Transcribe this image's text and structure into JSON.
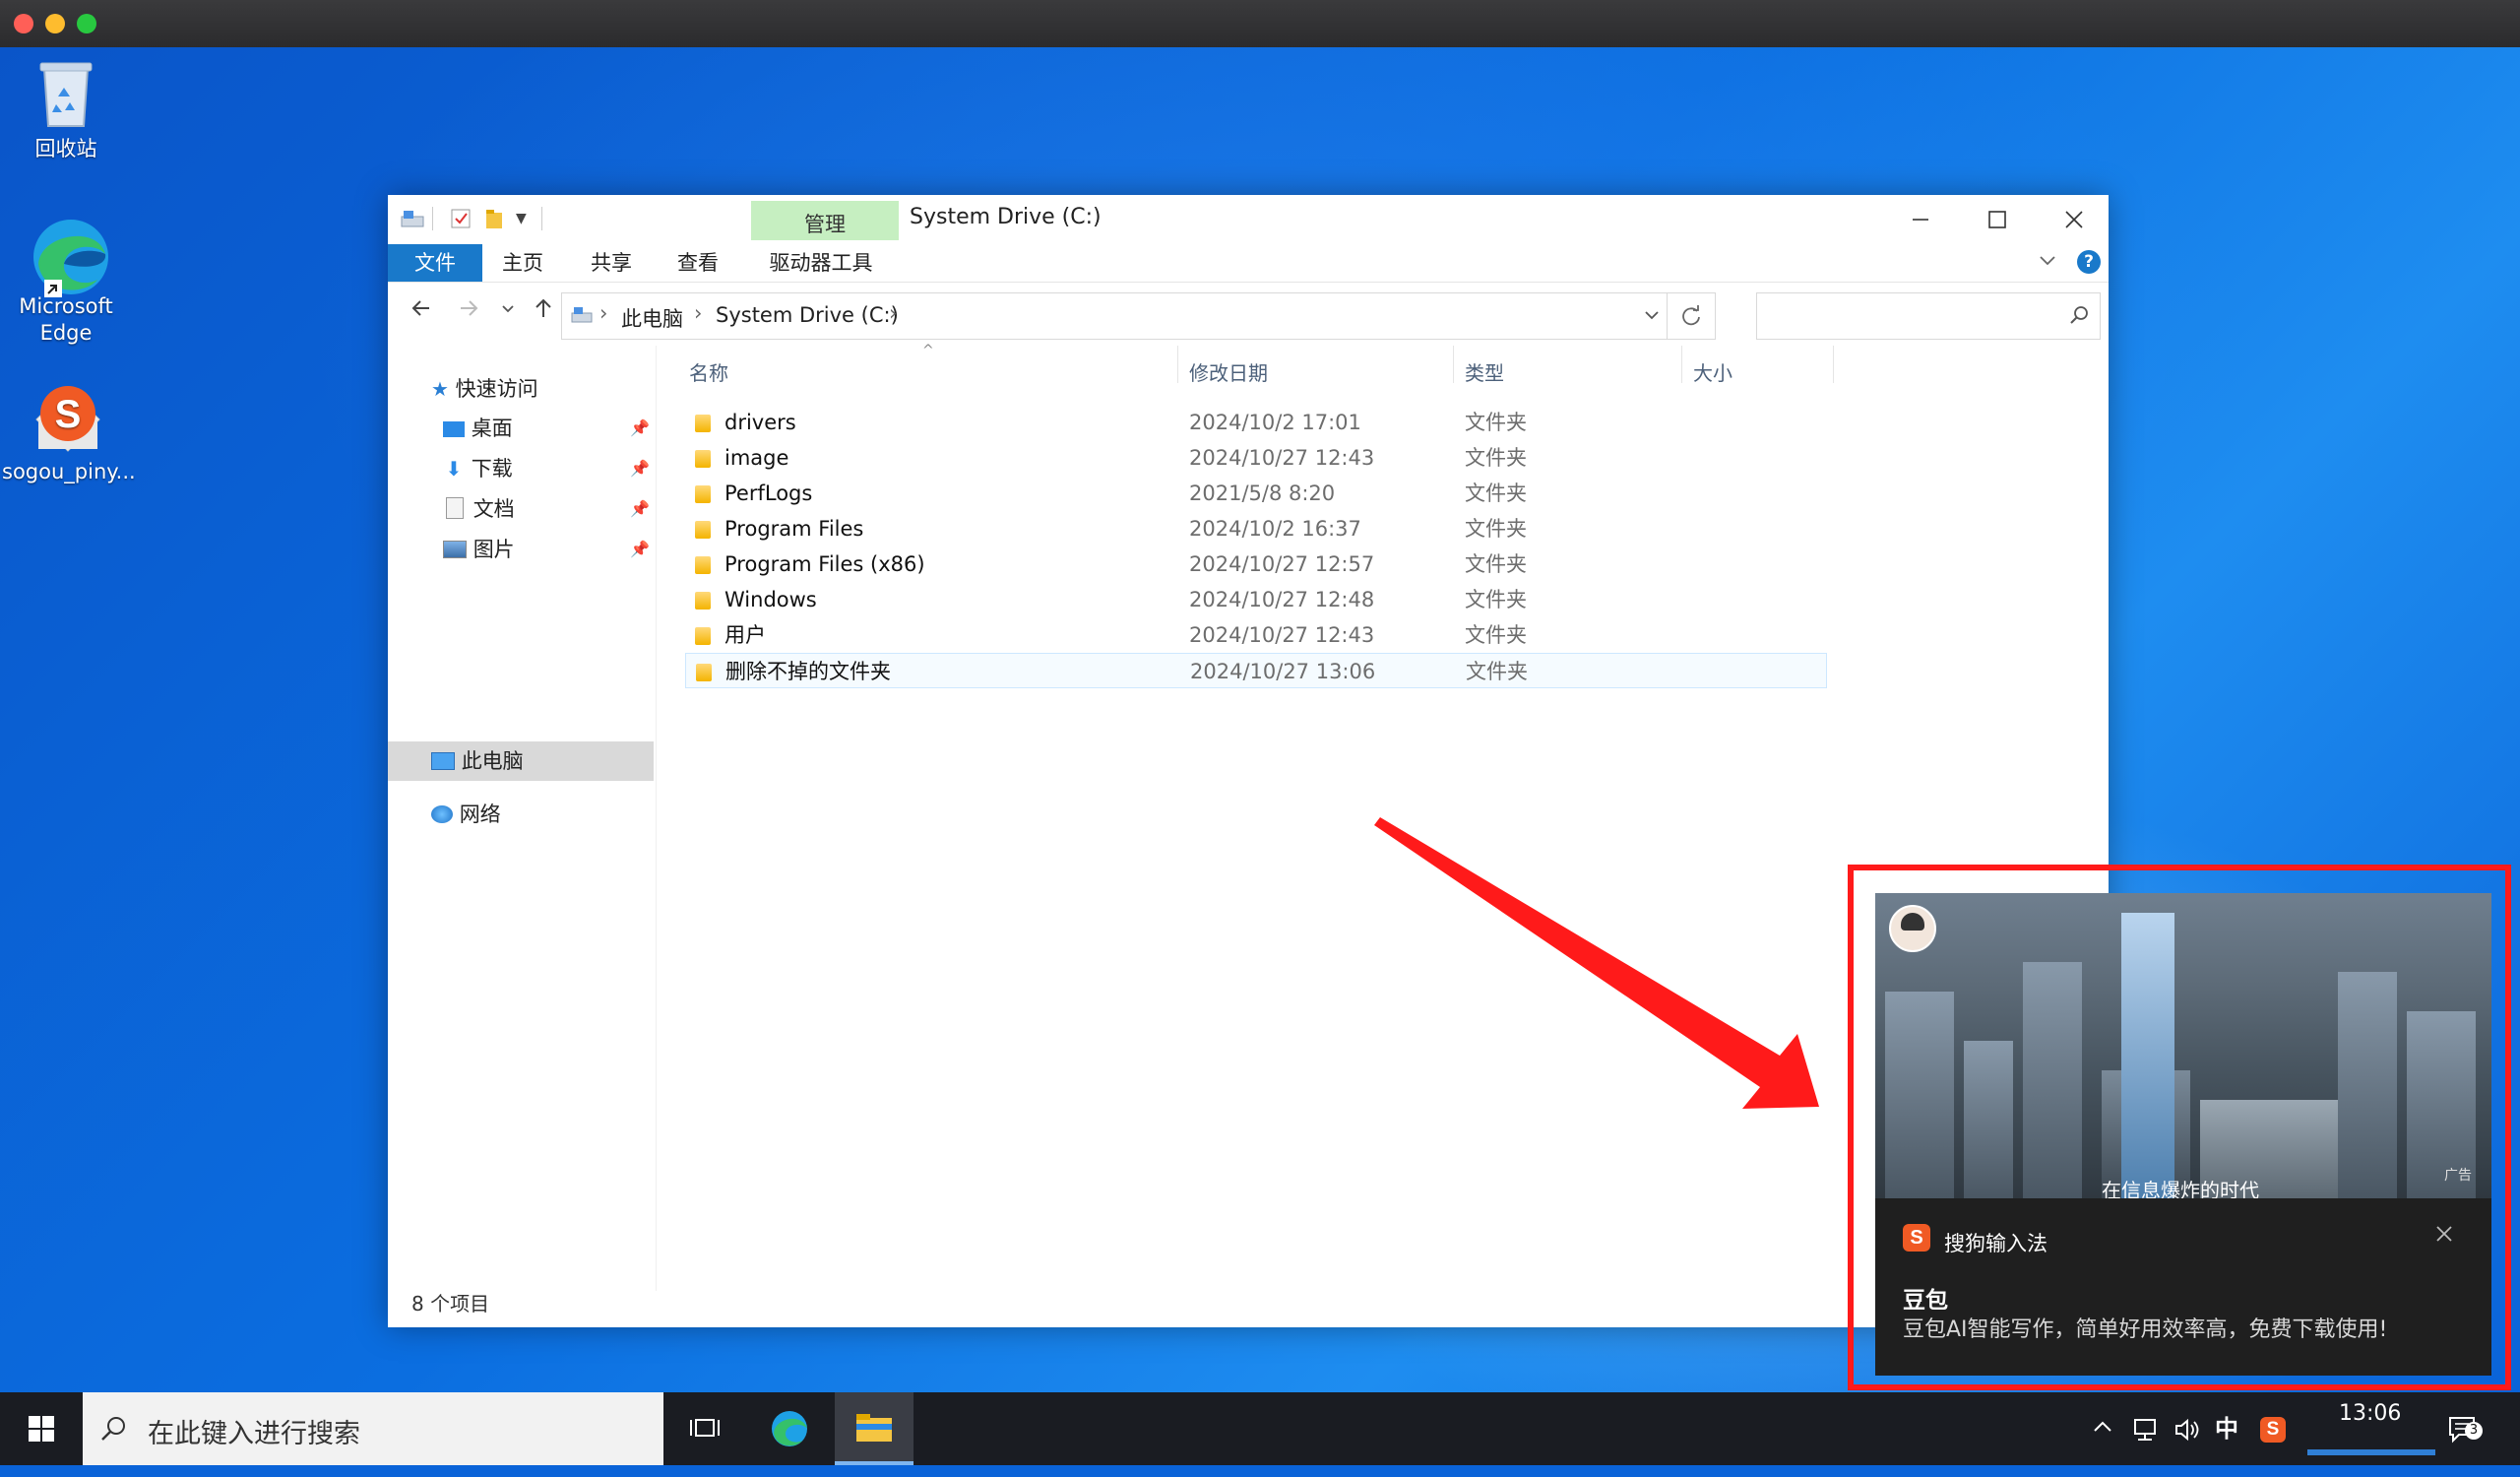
{
  "mac_window": {
    "dots": [
      "#ff5f57",
      "#febc2e",
      "#28c840"
    ]
  },
  "desktop_icons": [
    {
      "name": "recycle-bin",
      "label": "回收站"
    },
    {
      "name": "edge",
      "label": "Microsoft Edge"
    },
    {
      "name": "sogou",
      "label": "sogou_piny..."
    }
  ],
  "explorer": {
    "title": "System Drive (C:)",
    "context_tab": "管理",
    "ribbon_tabs": [
      "文件",
      "主页",
      "共享",
      "查看",
      "驱动器工具"
    ],
    "breadcrumb": [
      "此电脑",
      "System Drive (C:)"
    ],
    "search_placeholder": "",
    "nav": {
      "quick_access": "快速访问",
      "items": [
        "桌面",
        "下载",
        "文档",
        "图片"
      ],
      "this_pc": "此电脑",
      "network": "网络"
    },
    "columns": [
      "名称",
      "修改日期",
      "类型",
      "大小"
    ],
    "files": [
      {
        "name": "drivers",
        "date": "2024/10/2 17:01",
        "type": "文件夹"
      },
      {
        "name": "image",
        "date": "2024/10/27 12:43",
        "type": "文件夹"
      },
      {
        "name": "PerfLogs",
        "date": "2021/5/8 8:20",
        "type": "文件夹"
      },
      {
        "name": "Program Files",
        "date": "2024/10/2 16:37",
        "type": "文件夹"
      },
      {
        "name": "Program Files (x86)",
        "date": "2024/10/27 12:57",
        "type": "文件夹"
      },
      {
        "name": "Windows",
        "date": "2024/10/27 12:48",
        "type": "文件夹"
      },
      {
        "name": "用户",
        "date": "2024/10/27 12:43",
        "type": "文件夹"
      },
      {
        "name": "删除不掉的文件夹",
        "date": "2024/10/27 13:06",
        "type": "文件夹"
      }
    ],
    "status": "8 个项目"
  },
  "notification": {
    "app": "搜狗输入法",
    "ad_caption": "在信息爆炸的时代",
    "ad_badge": "广告",
    "title": "豆包",
    "body": "豆包AI智能写作，简单好用效率高，免费下载使用!"
  },
  "taskbar": {
    "search_placeholder": "在此键入进行搜索",
    "ime": "中",
    "time": "13:06",
    "notif_count": "3"
  },
  "colors": {
    "accent": "#1979ca",
    "highlight": "#ff1a1a"
  }
}
